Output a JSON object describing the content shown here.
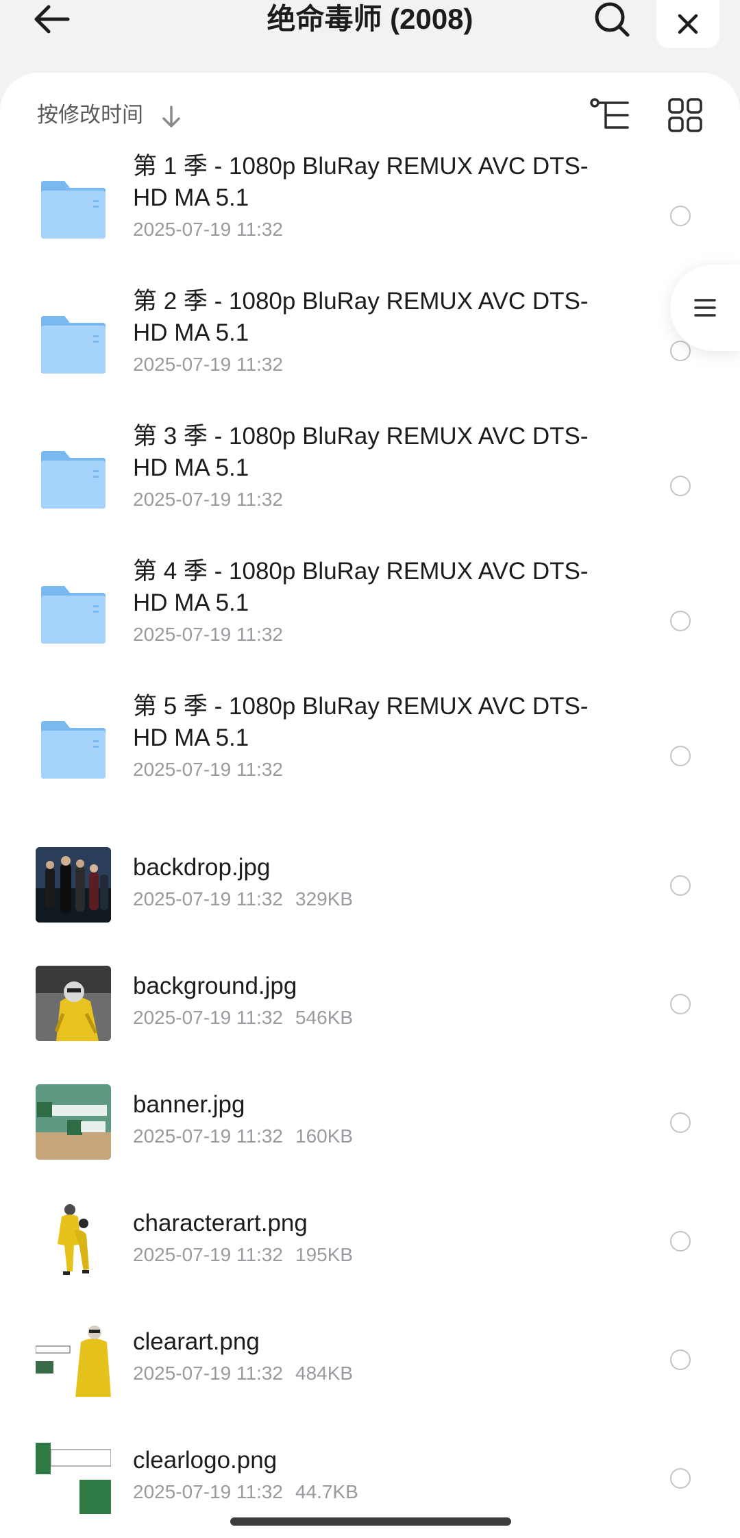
{
  "header": {
    "title": "绝命毒师 (2008)",
    "back_icon": "arrow-left-icon",
    "search_icon": "search-icon",
    "close_icon": "close-icon"
  },
  "toolbar": {
    "sort_label": "按修改时间",
    "sort_icon": "arrow-down-icon",
    "tree_icon": "tree-view-icon",
    "grid_icon": "grid-view-icon"
  },
  "folders": [
    {
      "name": "第 1 季 - 1080p BluRay REMUX AVC DTS-HD MA 5.1",
      "date": "2025-07-19 11:32"
    },
    {
      "name": "第 2 季 - 1080p BluRay REMUX AVC DTS-HD MA 5.1",
      "date": "2025-07-19 11:32"
    },
    {
      "name": "第 3 季 - 1080p BluRay REMUX AVC DTS-HD MA 5.1",
      "date": "2025-07-19 11:32"
    },
    {
      "name": "第 4 季 - 1080p BluRay REMUX AVC DTS-HD MA 5.1",
      "date": "2025-07-19 11:32"
    },
    {
      "name": "第 5 季 - 1080p BluRay REMUX AVC DTS-HD MA 5.1",
      "date": "2025-07-19 11:32"
    }
  ],
  "files": [
    {
      "name": "backdrop.jpg",
      "date": "2025-07-19 11:32",
      "size": "329KB"
    },
    {
      "name": "background.jpg",
      "date": "2025-07-19 11:32",
      "size": "546KB"
    },
    {
      "name": "banner.jpg",
      "date": "2025-07-19 11:32",
      "size": "160KB"
    },
    {
      "name": "characterart.png",
      "date": "2025-07-19 11:32",
      "size": "195KB"
    },
    {
      "name": "clearart.png",
      "date": "2025-07-19 11:32",
      "size": "484KB"
    },
    {
      "name": "clearlogo.png",
      "date": "2025-07-19 11:32",
      "size": "44.7KB"
    }
  ],
  "side_menu": {
    "icon": "menu-icon"
  },
  "colors": {
    "folder": "#8ec6f5",
    "background": "#f2f2f4",
    "sheet": "#ffffff",
    "meta_text": "#9a9aa0"
  }
}
